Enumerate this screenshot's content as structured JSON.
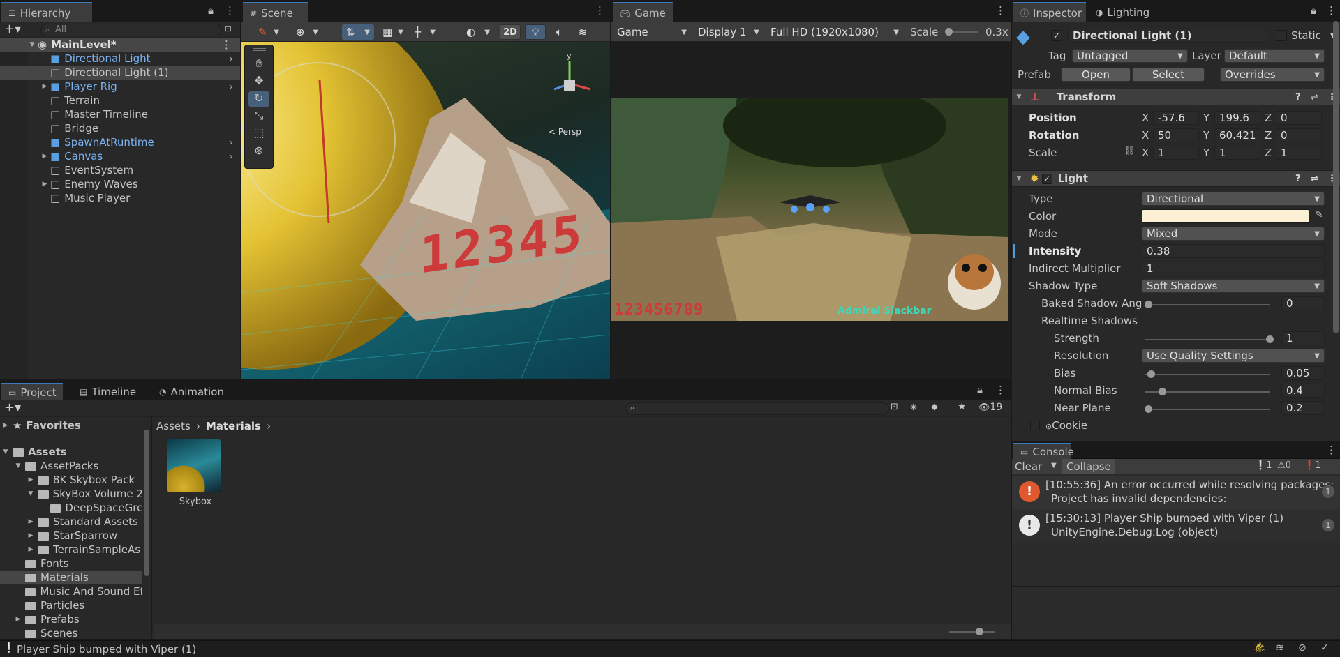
{
  "hierarchy": {
    "tab": "Hierarchy",
    "search_placeholder": "All",
    "scene_name": "MainLevel*",
    "items": [
      {
        "label": "Directional Light",
        "prefab": true
      },
      {
        "label": "Directional Light (1)",
        "prefab": false
      },
      {
        "label": "Player Rig",
        "prefab": true
      },
      {
        "label": "Terrain",
        "prefab": false
      },
      {
        "label": "Master Timeline",
        "prefab": false
      },
      {
        "label": "Bridge",
        "prefab": false
      },
      {
        "label": "SpawnAtRuntime",
        "prefab": true
      },
      {
        "label": "Canvas",
        "prefab": true
      },
      {
        "label": "EventSystem",
        "prefab": false
      },
      {
        "label": "Enemy Waves",
        "prefab": false
      },
      {
        "label": "Music Player",
        "prefab": false
      }
    ]
  },
  "scene": {
    "tab": "Scene",
    "mode_2d": "2D",
    "overlay_text": "12345",
    "persp": "< Persp"
  },
  "game": {
    "tab": "Game",
    "mode": "Game",
    "display": "Display 1",
    "resolution": "Full HD (1920x1080)",
    "scale_label": "Scale",
    "scale_value": "0.3x",
    "score": "123456789",
    "pilot": "Admiral Slackbar"
  },
  "inspector": {
    "tab": "Inspector",
    "tab2": "Lighting",
    "object_name": "Directional Light (1)",
    "static_label": "Static",
    "tag_label": "Tag",
    "tag_value": "Untagged",
    "layer_label": "Layer",
    "layer_value": "Default",
    "prefab_label": "Prefab",
    "open": "Open",
    "select": "Select",
    "overrides": "Overrides",
    "transform": {
      "title": "Transform",
      "position_label": "Position",
      "pos_x": "-57.6",
      "pos_y": "199.6",
      "pos_z": "0",
      "rotation_label": "Rotation",
      "rot_x": "50",
      "rot_y": "60.421",
      "rot_z": "0",
      "scale_label": "Scale",
      "scale_x": "1",
      "scale_y": "1",
      "scale_z": "1",
      "x": "X",
      "y": "Y",
      "z": "Z"
    },
    "light": {
      "title": "Light",
      "type_label": "Type",
      "type_value": "Directional",
      "color_label": "Color",
      "color_value": "#fbefd4",
      "mode_label": "Mode",
      "mode_value": "Mixed",
      "intensity_label": "Intensity",
      "intensity_value": "0.38",
      "indirect_label": "Indirect Multiplier",
      "indirect_value": "1",
      "shadow_type_label": "Shadow Type",
      "shadow_type_value": "Soft Shadows",
      "baked_angle_label": "Baked Shadow Ang",
      "baked_angle_value": "0",
      "realtime_label": "Realtime Shadows",
      "strength_label": "Strength",
      "strength_value": "1",
      "resolution_label": "Resolution",
      "resolution_value": "Use Quality Settings",
      "bias_label": "Bias",
      "bias_value": "0.05",
      "normal_bias_label": "Normal Bias",
      "normal_bias_value": "0.4",
      "near_plane_label": "Near Plane",
      "near_plane_value": "0.2",
      "cookie_label": "Cookie"
    }
  },
  "project": {
    "tabs": [
      "Project",
      "Timeline",
      "Animation"
    ],
    "favorites": "Favorites",
    "assets": "Assets",
    "tree": [
      {
        "label": "AssetPacks",
        "depth": 1,
        "expanded": true
      },
      {
        "label": "8K Skybox Pack",
        "depth": 2,
        "expanded": false
      },
      {
        "label": "SkyBox Volume 2",
        "depth": 2,
        "expanded": true
      },
      {
        "label": "DeepSpaceGre",
        "depth": 3,
        "expanded": null
      },
      {
        "label": "Standard Assets",
        "depth": 2,
        "expanded": false
      },
      {
        "label": "StarSparrow",
        "depth": 2,
        "expanded": false
      },
      {
        "label": "TerrainSampleAs",
        "depth": 2,
        "expanded": false
      },
      {
        "label": "Fonts",
        "depth": 1,
        "expanded": null
      },
      {
        "label": "Materials",
        "depth": 1,
        "expanded": null
      },
      {
        "label": "Music And Sound Ef",
        "depth": 1,
        "expanded": null
      },
      {
        "label": "Particles",
        "depth": 1,
        "expanded": null
      },
      {
        "label": "Prefabs",
        "depth": 1,
        "expanded": false
      },
      {
        "label": "Scenes",
        "depth": 1,
        "expanded": null
      }
    ],
    "breadcrumb": [
      "Assets",
      "Materials"
    ],
    "hidden_count": "19",
    "asset_name": "Skybox"
  },
  "console": {
    "tab": "Console",
    "clear": "Clear",
    "collapse": "Collapse",
    "count_log": "1",
    "count_warn": "0",
    "count_err": "1",
    "entries": [
      {
        "line1": "[10:55:36] An error occurred while resolving packages:",
        "line2": "Project has invalid dependencies:",
        "count": "1",
        "level": "error"
      },
      {
        "line1": "[15:30:13] Player Ship bumped with Viper (1)",
        "line2": "UnityEngine.Debug:Log (object)",
        "count": "1",
        "level": "log"
      }
    ]
  },
  "status_bar": {
    "message": "Player Ship bumped with Viper (1)"
  }
}
